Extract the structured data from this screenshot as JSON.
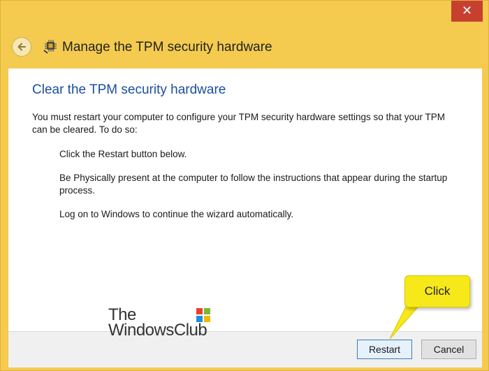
{
  "window": {
    "title": "Manage the TPM security hardware",
    "close_glyph": "✕",
    "frame_color": "#f4cb4f",
    "close_color": "#c7402f"
  },
  "page": {
    "heading": "Clear the TPM security hardware",
    "heading_color": "#1b4e9c",
    "intro": "You must restart your computer to configure your TPM security hardware settings so that your TPM can be cleared. To do so:",
    "steps": [
      "Click the Restart button below.",
      "Be Physically present at the computer to follow the instructions that appear during the startup process.",
      "Log on to Windows to continue the wizard automatically."
    ]
  },
  "footer": {
    "restart_label": "Restart",
    "cancel_label": "Cancel"
  },
  "watermark": {
    "line1": "The",
    "line2": "WindowsClub"
  },
  "callout": {
    "text": "Click",
    "color": "#f7e81a"
  },
  "icons": {
    "back": "back-arrow-icon",
    "app": "tpm-chip-icon",
    "close": "close-icon",
    "logo": "windows-flag-icon"
  }
}
